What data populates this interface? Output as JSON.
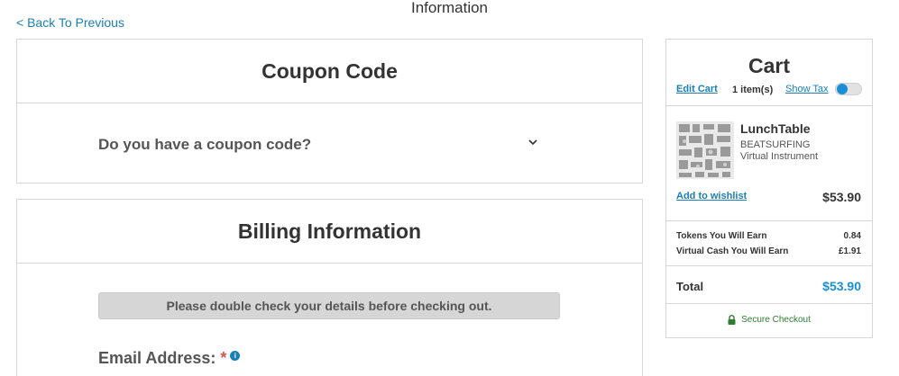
{
  "page": {
    "title": "Information"
  },
  "nav": {
    "back_label": "< Back To Previous"
  },
  "coupon": {
    "title": "Coupon Code",
    "question": "Do you have a coupon code?",
    "expand_icon": "chevron-down-icon"
  },
  "billing": {
    "title": "Billing Information",
    "notice": "Please double check your details before checking out.",
    "email_label": "Email Address:",
    "required_mark": "*",
    "info_icon_glyph": "i"
  },
  "cart": {
    "title": "Cart",
    "edit_label": "Edit Cart",
    "item_count": "1 item(s)",
    "show_tax_label": "Show Tax",
    "show_tax_enabled": false,
    "items": [
      {
        "name": "LunchTable",
        "brand": "BEATSURFING",
        "type": "Virtual Instrument",
        "wishlist_label": "Add to wishlist",
        "price": "$53.90"
      }
    ],
    "tokens_label": "Tokens You Will Earn",
    "tokens_value": "0.84",
    "cash_label": "Virtual Cash You Will Earn",
    "cash_value": "£1.91",
    "total_label": "Total",
    "total_value": "$53.90",
    "secure_label": "Secure Checkout"
  },
  "colors": {
    "link": "#1a7fb5",
    "accent": "#1a8fd6",
    "required": "#d9534f",
    "secure": "#2e7d32"
  }
}
